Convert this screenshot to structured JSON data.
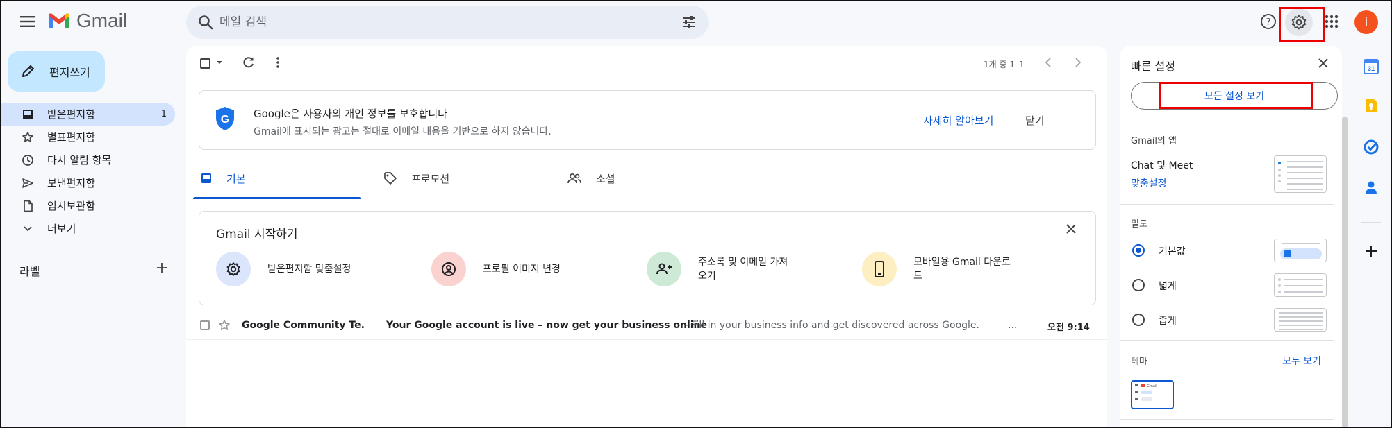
{
  "app": {
    "name": "Gmail",
    "brand_red": "#ea4335"
  },
  "search": {
    "placeholder": "메일 검색"
  },
  "header": {
    "avatar_letter": "i",
    "avatar_color": "#f4511e"
  },
  "compose": {
    "label": "편지쓰기"
  },
  "nav": {
    "items": [
      {
        "label": "받은편지함",
        "count": "1",
        "icon": "inbox-icon",
        "active": true
      },
      {
        "label": "별표편지함",
        "icon": "star-icon"
      },
      {
        "label": "다시 알림 항목",
        "icon": "clock-icon"
      },
      {
        "label": "보낸편지함",
        "icon": "send-icon"
      },
      {
        "label": "임시보관함",
        "icon": "draft-icon"
      },
      {
        "label": "더보기",
        "icon": "chevron-down-icon"
      }
    ],
    "labels_heading": "라벨"
  },
  "toolbar": {
    "pager_text": "1개 중 1–1"
  },
  "privacy": {
    "title": "Google은 사용자의 개인 정보를 보호합니다",
    "subtitle": "Gmail에 표시되는 광고는 절대로 이메일 내용을 기반으로 하지 않습니다.",
    "learn_more": "자세히 알아보기",
    "close": "닫기"
  },
  "tabs": [
    {
      "label": "기본",
      "icon": "inbox-icon",
      "active": true
    },
    {
      "label": "프로모션",
      "icon": "tag-icon"
    },
    {
      "label": "소셜",
      "icon": "people-icon"
    }
  ],
  "getting_started": {
    "title": "Gmail 시작하기",
    "items": [
      {
        "label": "받은편지함 맞춤설정",
        "icon": "settings-icon",
        "bg": "#dbe6fd"
      },
      {
        "label": "프로필 이미지 변경",
        "icon": "profile-icon",
        "bg": "#fad2cf"
      },
      {
        "label": "주소록 및 이메일 가져오기",
        "icon": "add-contact-icon",
        "bg": "#ceead6"
      },
      {
        "label": "모바일용 Gmail 다운로드",
        "icon": "phone-icon",
        "bg": "#feefc3"
      }
    ]
  },
  "mail": [
    {
      "sender": "Google Community Te.",
      "subject": "Your Google account is live – now get your business online",
      "snippet": "- Fill in your business info and get discovered across Google.",
      "ellipsis": "...",
      "time": "오전 9:14"
    }
  ],
  "quick_settings": {
    "title": "빠른 설정",
    "all_settings": "모든 설정 보기",
    "apps_heading": "Gmail의 앱",
    "chat_meet": "Chat 및 Meet",
    "customize": "맞춤설정",
    "density_heading": "밀도",
    "density_options": [
      {
        "label": "기본값",
        "selected": true
      },
      {
        "label": "넓게",
        "selected": false
      },
      {
        "label": "좁게",
        "selected": false
      }
    ],
    "theme_heading": "테마",
    "view_all": "모두 보기",
    "theme_thumb_label": "Gmail"
  },
  "side_panel": {
    "calendar_day": "31",
    "icons": [
      "calendar-icon",
      "keep-icon",
      "tasks-icon",
      "contacts-icon",
      "add-icon"
    ]
  }
}
